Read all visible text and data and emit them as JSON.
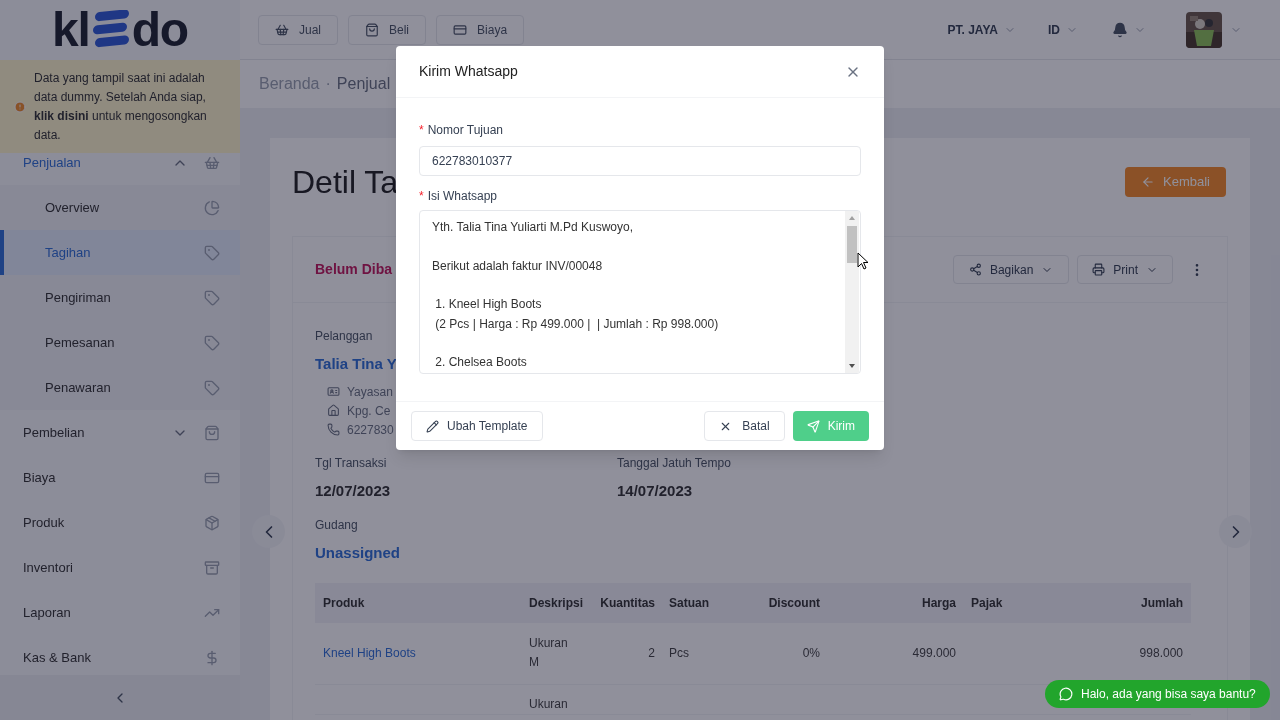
{
  "logo": {
    "before": "kl",
    "after": "do"
  },
  "notice": "Data yang tampil saat ini adalah data dummy. Setelah Anda siap, **klik disini** untuk mengosongkan data.",
  "sidebar": {
    "items": [
      {
        "label": "Penjualan",
        "selected": false,
        "expanded": true,
        "children": [
          {
            "label": "Overview",
            "selected": false
          },
          {
            "label": "Tagihan",
            "selected": true
          },
          {
            "label": "Pengiriman",
            "selected": false
          },
          {
            "label": "Pemesanan",
            "selected": false
          },
          {
            "label": "Penawaran",
            "selected": false
          }
        ]
      },
      {
        "label": "Pembelian",
        "selected": false,
        "expanded": false
      },
      {
        "label": "Biaya",
        "selected": false
      },
      {
        "label": "Produk",
        "selected": false
      },
      {
        "label": "Inventori",
        "selected": false
      },
      {
        "label": "Laporan",
        "selected": false
      },
      {
        "label": "Kas & Bank",
        "selected": false
      }
    ]
  },
  "topbar": {
    "quick_buttons": [
      "Jual",
      "Beli",
      "Biaya"
    ],
    "company": "PT. JAYA",
    "language": "ID"
  },
  "breadcrumb": {
    "items": [
      "Beranda",
      "Penjual"
    ],
    "separator": "·"
  },
  "page": {
    "title": "Detil Ta",
    "back_button": "Kembali"
  },
  "invoice": {
    "status": "Belum Diba",
    "actions": [
      "Bagikan",
      "Print"
    ],
    "customer_label": "Pelanggan",
    "customer_name": "Talia Tina Y",
    "customer_lines": [
      "Yayasan",
      "Kpg. Ce",
      "6227830"
    ],
    "fields": [
      {
        "label": "Tgl Transaksi",
        "value": "12/07/2023"
      },
      {
        "label": "Tanggal Jatuh Tempo",
        "value": "14/07/2023"
      },
      {
        "label": "Gudang",
        "value": "Unassigned"
      }
    ]
  },
  "table": {
    "columns": [
      "Produk",
      "Deskripsi",
      "Kuantitas",
      "Satuan",
      "Discount",
      "Harga",
      "Pajak",
      "Jumlah"
    ],
    "rows": [
      {
        "produk": "Kneel High Boots",
        "deskripsi": "Ukuran M",
        "kuantitas": "2",
        "satuan": "Pcs",
        "discount": "0%",
        "harga": "499.000",
        "jumlah": "998.000"
      },
      {
        "deskripsi": "Ukuran"
      }
    ]
  },
  "modal": {
    "title": "Kirim Whatsapp",
    "required_mark": "*",
    "phone": {
      "label": "Nomor Tujuan",
      "value": "622783010377"
    },
    "message": {
      "label": "Isi Whatsapp",
      "paragraphs": [
        "Yth. Talia Tina Yuliarti M.Pd Kuswoyo,",
        "Berikut adalah faktur INV/00048",
        " 1. Kneel High Boots\n (2 Pcs | Harga : Rp 499.000 |  | Jumlah : Rp 998.000)",
        " 2. Chelsea Boots"
      ]
    },
    "buttons": {
      "template": "Ubah Template",
      "cancel": "Batal",
      "send": "Kirim"
    }
  },
  "chat": {
    "text": "Halo, ada yang bisa saya bantu?"
  }
}
